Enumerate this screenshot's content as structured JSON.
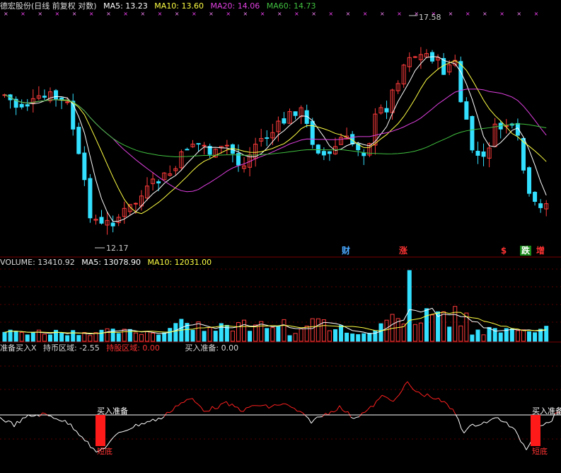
{
  "header": {
    "stock_title": "德宏股份(日线 前复权 对数)",
    "ma5_label": "MA5: 13.23",
    "ma10_label": "MA10: 13.60",
    "ma20_label": "MA20: 14.06",
    "ma60_label": "MA60: 14.73"
  },
  "price_panel": {
    "high_label": "17.58",
    "low_label": "12.17",
    "badges": [
      {
        "text": "财",
        "color": "#4aa8ff",
        "bg": "#000000"
      },
      {
        "text": "涨",
        "color": "#ff3333",
        "bg": "#000000"
      },
      {
        "text": "$",
        "color": "#ff3333",
        "bg": "#000000"
      },
      {
        "text": "跌",
        "color": "#ffffff",
        "bg": "#1a8a1a"
      },
      {
        "text": "增",
        "color": "#ff3333",
        "bg": "#000000"
      }
    ]
  },
  "volume_panel": {
    "volume_label": "VOLUME: 13410.92",
    "ma5_label": "MA5: 13078.90",
    "ma10_label": "MA10: 12031.00"
  },
  "indicator_panel": {
    "title": "准备买入X",
    "holding_coin_label": "持币区域: -2.55",
    "holding_stock_label": "持股区域: 0.00",
    "buy_prepare_label": "买入准备: 0.00",
    "annotation_buy": "买入准备",
    "annotation_bottom": "短底"
  },
  "colors": {
    "up": "#ff3b3b",
    "down": "#33e0ff",
    "ma5": "#ffffff",
    "ma10": "#ffff44",
    "ma20": "#e040e0",
    "ma60": "#40c040",
    "separator": "#7a0000",
    "indicator_up": "#ff2020",
    "indicator_down": "#ffffff"
  },
  "chart_data": {
    "type": "candlestick",
    "high": 17.58,
    "low": 12.17,
    "ma_values": {
      "MA5": 13.23,
      "MA10": 13.6,
      "MA20": 14.06,
      "MA60": 14.73
    },
    "volume_values": {
      "VOLUME": 13410.92,
      "MA5": 13078.9,
      "MA10": 12031.0
    },
    "indicator_values": {
      "持币区域": -2.55,
      "持股区域": 0.0,
      "买入准备": 0.0
    }
  }
}
